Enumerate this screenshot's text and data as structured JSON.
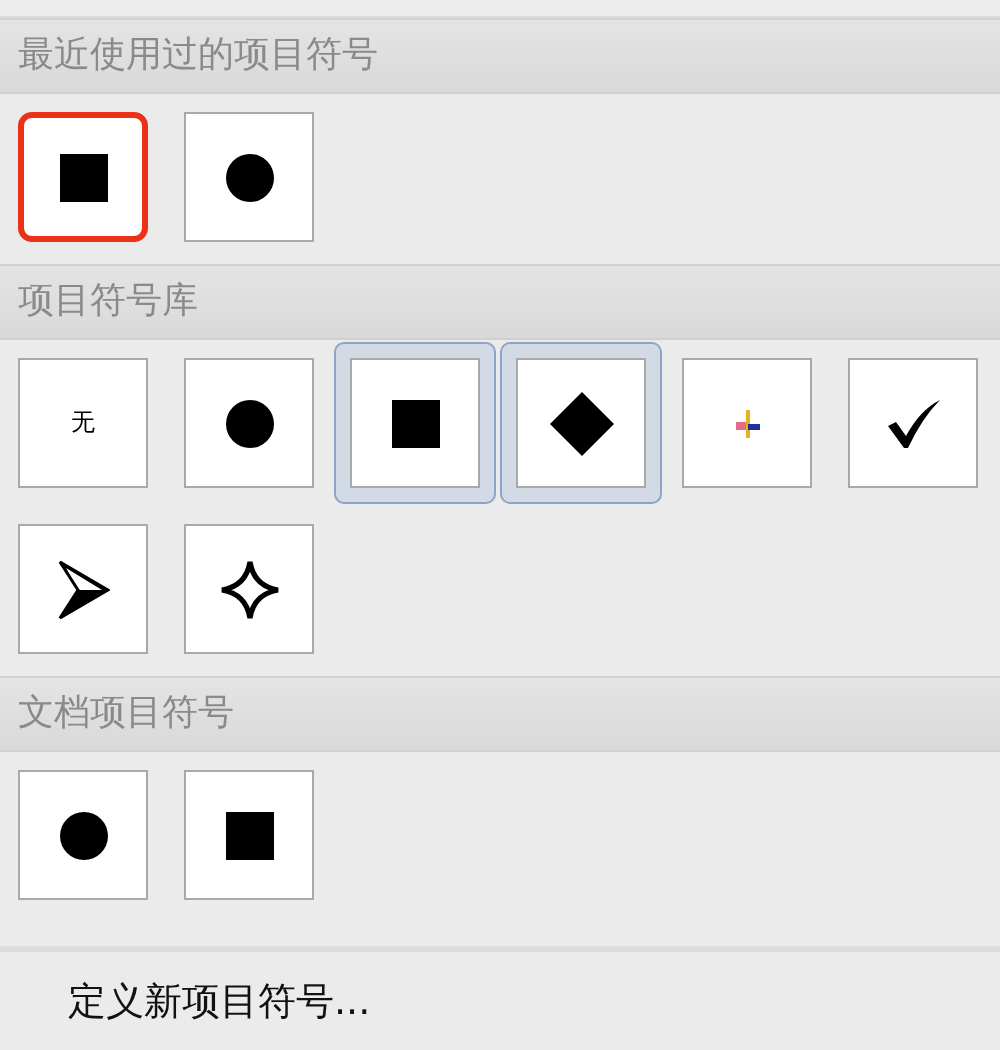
{
  "sections": [
    {
      "title": "最近使用过的项目符号",
      "items": [
        {
          "kind": "square",
          "highlighted": true
        },
        {
          "kind": "circle",
          "highlighted": false
        }
      ]
    },
    {
      "title": "项目符号库",
      "items": [
        {
          "kind": "none",
          "label": "无",
          "selected": false
        },
        {
          "kind": "circle",
          "selected": false
        },
        {
          "kind": "square",
          "selected": true
        },
        {
          "kind": "diamond",
          "selected": true
        },
        {
          "kind": "colored-glyph",
          "selected": false
        },
        {
          "kind": "check",
          "selected": false
        },
        {
          "kind": "arrowhead",
          "selected": false
        },
        {
          "kind": "star",
          "selected": false
        }
      ]
    },
    {
      "title": "文档项目符号",
      "items": [
        {
          "kind": "circle"
        },
        {
          "kind": "square"
        }
      ]
    }
  ],
  "menu_item": "定义新项目符号..."
}
